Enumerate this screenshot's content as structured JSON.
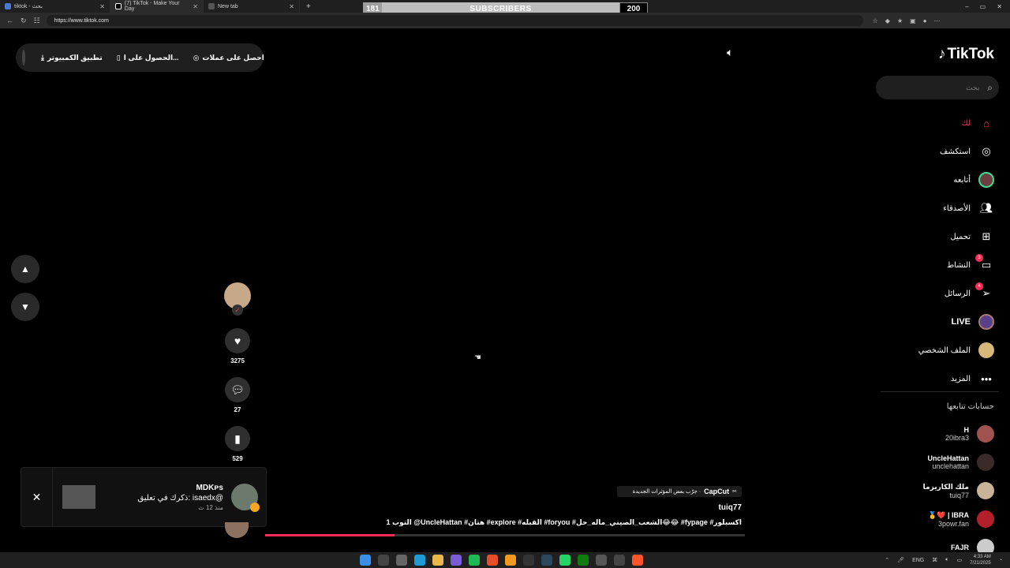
{
  "browser": {
    "tabs": [
      {
        "label": "tiktok - بحث",
        "active": false
      },
      {
        "label": "(7) TikTok - Make Your Day",
        "active": true
      },
      {
        "label": "New tab",
        "active": false
      }
    ],
    "url": "https://www.tiktok.com"
  },
  "subscriber_bar": {
    "current": "181",
    "label": "SUBSCRIBERS",
    "goal": "200"
  },
  "topbar": {
    "coins": "احصل على عملات",
    "get_app": "الحصول على ا...",
    "desktop_app": "تطبيق الكمبيوتر"
  },
  "video": {
    "capcut_brand": "CapCut",
    "capcut_text": "جرّب بعض المؤثرات الجديدة ·",
    "author": "tuiq77",
    "caption": "التوب 1 @UncleHattan  #هتان  #explore  #القبله  #foryou  #الشعب_الصيني_ماله_حل😂😂  #fypage  #اكسبلور",
    "progress_percent": 27
  },
  "actions": {
    "likes": "3275",
    "comments": "27",
    "saves": "529"
  },
  "notification": {
    "title": "MDKᴘs",
    "message": "ذكرك في تعليق: isaedx@",
    "time": "منذ 12 ث"
  },
  "sidebar": {
    "logo": "TikTok",
    "search_placeholder": "بحث",
    "menu": [
      {
        "label": "لك",
        "icon": "home-icon"
      },
      {
        "label": "استكشف",
        "icon": "compass-icon"
      },
      {
        "label": "أتابعه",
        "icon": "avatar-icon"
      },
      {
        "label": "الأصدقاء",
        "icon": "friends-icon"
      },
      {
        "label": "تحميل",
        "icon": "upload-icon"
      },
      {
        "label": "النشاط",
        "icon": "activity-icon",
        "badge": "3"
      },
      {
        "label": "الرسائل",
        "icon": "messages-icon",
        "badge": "4"
      },
      {
        "label": "LIVE",
        "icon": "live-icon"
      },
      {
        "label": "الملف الشخصي",
        "icon": "profile-icon"
      },
      {
        "label": "المزيد",
        "icon": "more-icon"
      }
    ],
    "following_header": "حسابات تتابعها",
    "following": [
      {
        "name": "H",
        "handle": "20ibra3"
      },
      {
        "name": "UncleHattan",
        "handle": "unclehattan"
      },
      {
        "name": "ملك الكاريزما",
        "handle": "tuiq77"
      },
      {
        "name": "🥇❤️ | IBRA",
        "handle": "3powr.fan"
      },
      {
        "name": "FAJR",
        "handle": ""
      }
    ]
  },
  "taskbar": {
    "lang": "ENG",
    "time": "4:33 AM",
    "date": "7/21/2025"
  }
}
